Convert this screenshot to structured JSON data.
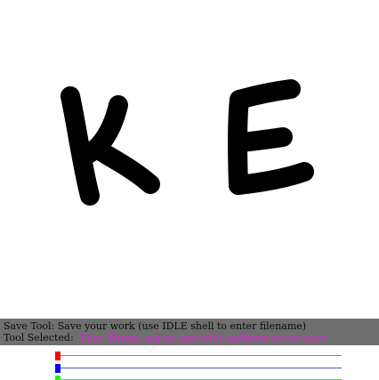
{
  "canvas": {
    "letters": [
      "K",
      "E"
    ],
    "stroke_color": "#000000",
    "background": "#ffffff"
  },
  "status": {
    "line1": "Save Tool: Save your work (use IDLE shell to enter filename)",
    "line2_label": "Tool Selected:",
    "line2_value": "Paint Brush, adjust size with up/down arrow keys",
    "bar_color": "#6f6f6f",
    "highlight_color": "#e21fe0"
  },
  "color_sliders": [
    {
      "name": "red",
      "track_color": "#e06060",
      "knob_color": "#ff0000",
      "level": 0
    },
    {
      "name": "blue",
      "track_color": "#5050e0",
      "knob_color": "#0000ff",
      "level": 0
    },
    {
      "name": "green",
      "track_color": "#60d060",
      "knob_color": "#00ff00",
      "level": 0
    }
  ]
}
